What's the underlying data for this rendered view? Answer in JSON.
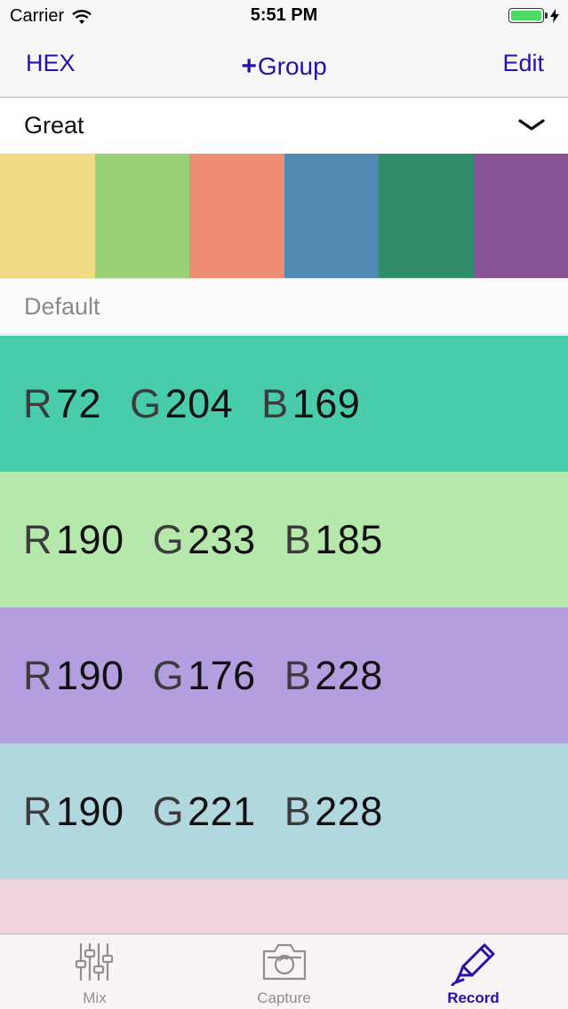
{
  "status_bar": {
    "carrier": "Carrier",
    "time": "5:51 PM",
    "battery_level": 1.0,
    "battery_color": "#4cd964"
  },
  "nav": {
    "left_label": "HEX",
    "center_plus": "+",
    "center_label": "Group",
    "right_label": "Edit",
    "accent_color": "#2a10a6"
  },
  "group_selector": {
    "selected": "Great",
    "icon": "chevron-down-icon"
  },
  "palette": [
    "#f0da86",
    "#99d176",
    "#ec8c70",
    "#508ab2",
    "#2f8d69",
    "#875496"
  ],
  "section": {
    "title": "Default"
  },
  "colors": [
    {
      "r_key": "R",
      "r": "72",
      "g_key": "G",
      "g": "204",
      "b_key": "B",
      "b": "169",
      "bg": "#48cca9"
    },
    {
      "r_key": "R",
      "r": "190",
      "g_key": "G",
      "g": "233",
      "b_key": "B",
      "b": "185",
      "bg": "#b5e8aa"
    },
    {
      "r_key": "R",
      "r": "190",
      "g_key": "G",
      "g": "176",
      "b_key": "B",
      "b": "228",
      "bg": "#b39fdf"
    },
    {
      "r_key": "R",
      "r": "190",
      "g_key": "G",
      "g": "221",
      "b_key": "B",
      "b": "228",
      "bg": "#b1d7df"
    },
    {
      "bg": "#f1d3dd"
    }
  ],
  "tabs": [
    {
      "label": "Mix",
      "icon": "sliders-icon",
      "active": false
    },
    {
      "label": "Capture",
      "icon": "camera-icon",
      "active": false
    },
    {
      "label": "Record",
      "icon": "pencil-icon",
      "active": true
    }
  ]
}
